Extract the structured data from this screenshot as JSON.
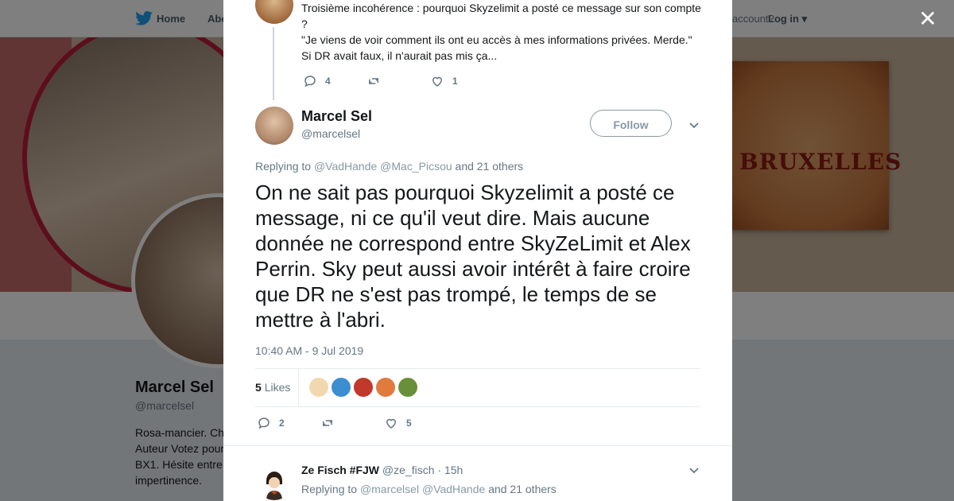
{
  "nav": {
    "home": "Home",
    "about": "Abo",
    "account_q": "account?",
    "login": "Log in"
  },
  "profile": {
    "name": "Marcel Sel",
    "handle": "@marcelsel",
    "bio": "Rosa-mancier. Ch\nAuteur Votez pour\nBX1. Hésite entre\nimpertinence.",
    "poster_text": "BRUXELLES"
  },
  "prev_tweet": {
    "lines": [
      "Troisième incohérence : pourquoi Skyzelimit a posté ce message sur son compte ?",
      "\"Je viens de voir comment ils ont eu accès à mes informations privées. Merde.\"",
      "Si DR avait faux, il n'aurait pas mis ça..."
    ],
    "replies": "4",
    "retweets": "",
    "likes": "1"
  },
  "main_tweet": {
    "name": "Marcel Sel",
    "handle": "@marcelsel",
    "follow_label": "Follow",
    "replying_prefix": "Replying to",
    "mention1": "@VadHande",
    "mention2": "@Mac_Picsou",
    "others": "and 21 others",
    "text": "On ne sait pas pourquoi Skyzelimit a posté ce message, ni ce qu'il veut dire. Mais aucune donnée ne correspond entre SkyZeLimit et Alex Perrin. Sky peut aussi avoir intérêt à faire croire que DR ne s'est pas trompé, le temps de se mettre à l'abri.",
    "timestamp": "10:40 AM - 9 Jul 2019",
    "likes_count": "5",
    "likes_label": "Likes",
    "likers": [
      {
        "color": "#f2d8b0"
      },
      {
        "color": "#3b8fd1"
      },
      {
        "color": "#c0392b"
      },
      {
        "color": "#e07b3c"
      },
      {
        "color": "#6a8f3a"
      }
    ],
    "replies": "2",
    "retweets": "",
    "likes": "5"
  },
  "reply_tweet": {
    "name": "Ze Fisch #FJW",
    "handle": "@ze_fisch",
    "time": "· 15h",
    "replying_prefix": "Replying to",
    "mention1": "@marcelsel",
    "mention2": "@VadHande",
    "others": "and 21 others"
  },
  "colors": {
    "accent": "#1da1f2",
    "gray": "#657786",
    "light_gray": "#8899a6"
  }
}
